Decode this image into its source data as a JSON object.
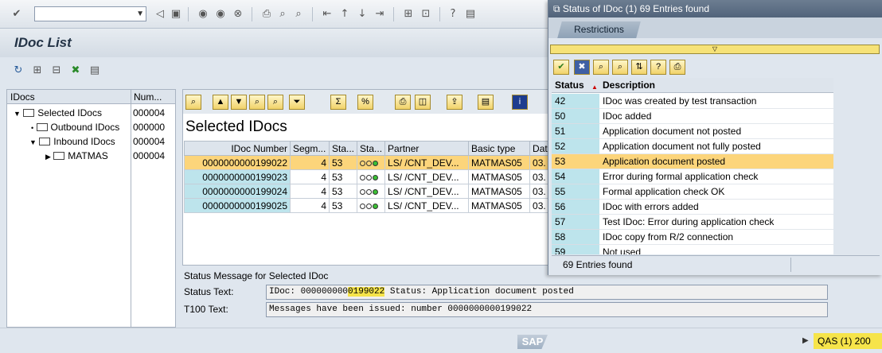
{
  "toolbar": {
    "command_placeholder": "",
    "icons": [
      "enter-icon",
      "back-icon",
      "save-icon",
      "back-arrow-icon",
      "exit-icon",
      "cancel-icon",
      "print-icon",
      "find-icon",
      "find-next-icon",
      "first-page-icon",
      "prev-page-icon",
      "next-page-icon",
      "last-page-icon",
      "new-session-icon",
      "shortcut-icon",
      "help-icon",
      "layout-icon"
    ]
  },
  "title": "IDoc List",
  "tree": {
    "col_idocs": "IDocs",
    "col_num": "Num...",
    "rows": [
      {
        "label": "Selected IDocs",
        "num": "000004"
      },
      {
        "label": "Outbound IDocs",
        "num": "000000"
      },
      {
        "label": "Inbound IDocs",
        "num": "000004"
      },
      {
        "label": "MATMAS",
        "num": "000004"
      }
    ]
  },
  "grid": {
    "title": "Selected IDocs",
    "headers": [
      "IDoc Number",
      "Segm...",
      "Sta...",
      "Sta...",
      "Partner",
      "Basic type",
      "Dat"
    ],
    "rows": [
      {
        "idoc": "0000000000199022",
        "seg": "4",
        "status": "53",
        "partner": "LS/  /CNT_DEV...",
        "type": "MATMAS05",
        "date": "03."
      },
      {
        "idoc": "0000000000199023",
        "seg": "4",
        "status": "53",
        "partner": "LS/  /CNT_DEV...",
        "type": "MATMAS05",
        "date": "03."
      },
      {
        "idoc": "0000000000199024",
        "seg": "4",
        "status": "53",
        "partner": "LS/  /CNT_DEV...",
        "type": "MATMAS05",
        "date": "03."
      },
      {
        "idoc": "0000000000199025",
        "seg": "4",
        "status": "53",
        "partner": "LS/  /CNT_DEV...",
        "type": "MATMAS05",
        "date": "03."
      }
    ]
  },
  "status_message": {
    "title": "Status Message for Selected IDoc",
    "status_label": "Status Text:",
    "status_pre": "IDoc: 000000000",
    "status_hl": "0199022",
    "status_post": " Status: Application document posted",
    "t100_label": "T100 Text:",
    "t100_value": "Messages have been issued: number 0000000000199022"
  },
  "popup": {
    "title": "Status of IDoc (1)   69 Entries found",
    "tab": "Restrictions",
    "col_status": "Status",
    "col_desc": "Description",
    "rows": [
      {
        "code": "42",
        "desc": "IDoc was created by test transaction"
      },
      {
        "code": "50",
        "desc": "IDoc added"
      },
      {
        "code": "51",
        "desc": "Application document not posted"
      },
      {
        "code": "52",
        "desc": "Application document not fully posted"
      },
      {
        "code": "53",
        "desc": "Application document posted"
      },
      {
        "code": "54",
        "desc": "Error during formal application check"
      },
      {
        "code": "55",
        "desc": "Formal application check OK"
      },
      {
        "code": "56",
        "desc": "IDoc with errors added"
      },
      {
        "code": "57",
        "desc": "Test IDoc: Error during application check"
      },
      {
        "code": "58",
        "desc": "IDoc copy from R/2 connection"
      },
      {
        "code": "59",
        "desc": "Not used"
      }
    ],
    "footer": "69 Entries found"
  },
  "footer": {
    "logo": "SAP",
    "system": "QAS (1) 200"
  },
  "colors": {
    "selected_row": "#fcd57b",
    "key_cell": "#bde4ec",
    "highlight": "#f6e44a"
  }
}
